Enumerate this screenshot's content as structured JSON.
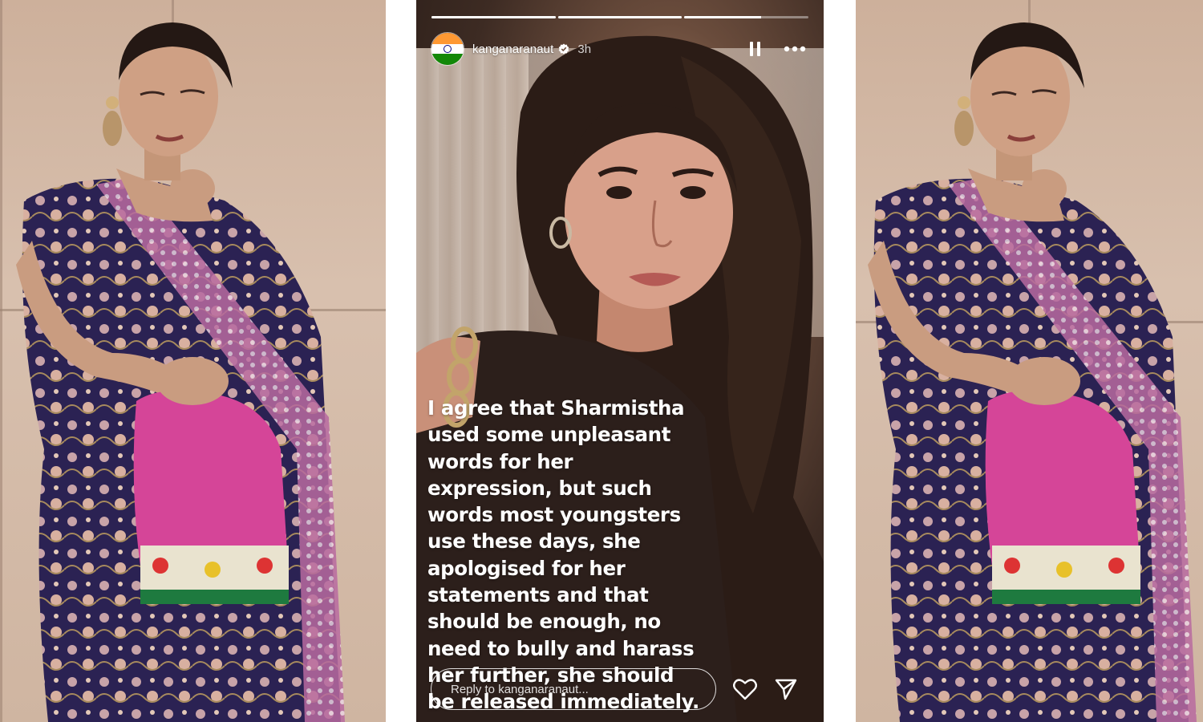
{
  "story": {
    "progress": [
      1.0,
      1.0,
      0.62,
      0.0
    ],
    "username": "kanganaranaut",
    "verified": true,
    "time_ago": "3h",
    "caption": "I agree that Sharmistha\nused some unpleasant\nwords for her\nexpression, but such\nwords most youngsters\nuse these days, she\napologised for her\nstatements and that\nshould be enough, no\nneed to bully and harass\nher further, she should\nbe released immediately.",
    "reply_placeholder": "Reply to kanganaranaut...",
    "icons": {
      "avatar": "india-flag-avatar",
      "verified": "verified-badge-icon",
      "pause": "pause-icon",
      "more": "more-options-icon",
      "like": "heart-icon",
      "share": "send-icon"
    }
  },
  "colors": {
    "saffron": "#ff9933",
    "green": "#138808",
    "navy": "#000080",
    "verified_blue": "#ffffff"
  }
}
